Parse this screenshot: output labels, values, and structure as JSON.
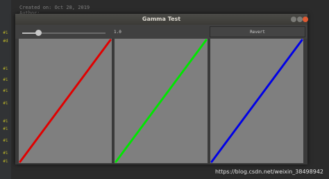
{
  "editor": {
    "lines": [
      "Created on: Oct 28, 2019",
      "    Author: …"
    ],
    "gutter_marks": [
      "#i",
      "#d",
      "#i",
      "#i",
      "#i",
      "#i",
      "#i",
      "#i",
      "#i",
      "#i",
      "#i"
    ]
  },
  "window": {
    "title": "Gamma Test",
    "slider_value": "1.0",
    "slider_fraction": 0.19,
    "revert_label": "Revert"
  },
  "panels": [
    {
      "color": "#e00000"
    },
    {
      "color": "#00e600"
    },
    {
      "color": "#0000e6"
    }
  ],
  "watermark": "https://blog.csdn.net/weixin_38498942"
}
